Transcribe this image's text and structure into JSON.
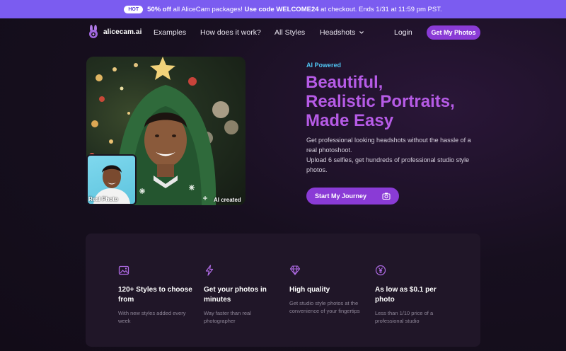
{
  "promo": {
    "badge": "HOT",
    "highlight": "50% off",
    "text1": " all AliceCam packages! ",
    "code": "Use code WELCOME24",
    "text2": " at checkout. Ends 1/31 at 11:59 pm PST."
  },
  "nav": {
    "brand": "alicecam.ai",
    "links": [
      "Examples",
      "How does it work?",
      "All Styles",
      "Headshots"
    ],
    "login": "Login",
    "cta": "Get My Photos"
  },
  "hero": {
    "eyebrow": "AI Powered",
    "title_lines": [
      "Beautiful,",
      "Realistic Portraits,",
      "Made Easy"
    ],
    "desc_lines": [
      "Get professional looking headshots without the hassle of a",
      "real photoshoot.",
      "Upload 6 selfies, get hundreds of professional studio style",
      "photos."
    ],
    "cta": "Start My Journey",
    "label_real": "Real Photo",
    "label_ai": "AI created"
  },
  "features": [
    {
      "icon": "image-icon",
      "title": "120+ Styles to choose from",
      "desc": "With new styles added every week"
    },
    {
      "icon": "lightning-icon",
      "title": "Get your photos in minutes",
      "desc": "Way faster than real photographer"
    },
    {
      "icon": "diamond-icon",
      "title": "High quality",
      "desc": "Get studio style photos at the convenience of your fingertips"
    },
    {
      "icon": "yen-coin-icon",
      "title": "As low as $0.1 per photo",
      "desc": "Less than 1/10 price of a professional studio"
    }
  ],
  "colors": {
    "accent": "#8a3bd6",
    "banner": "#7b5cf0",
    "title": "#b65be6",
    "eyebrow": "#4fc2f0"
  }
}
